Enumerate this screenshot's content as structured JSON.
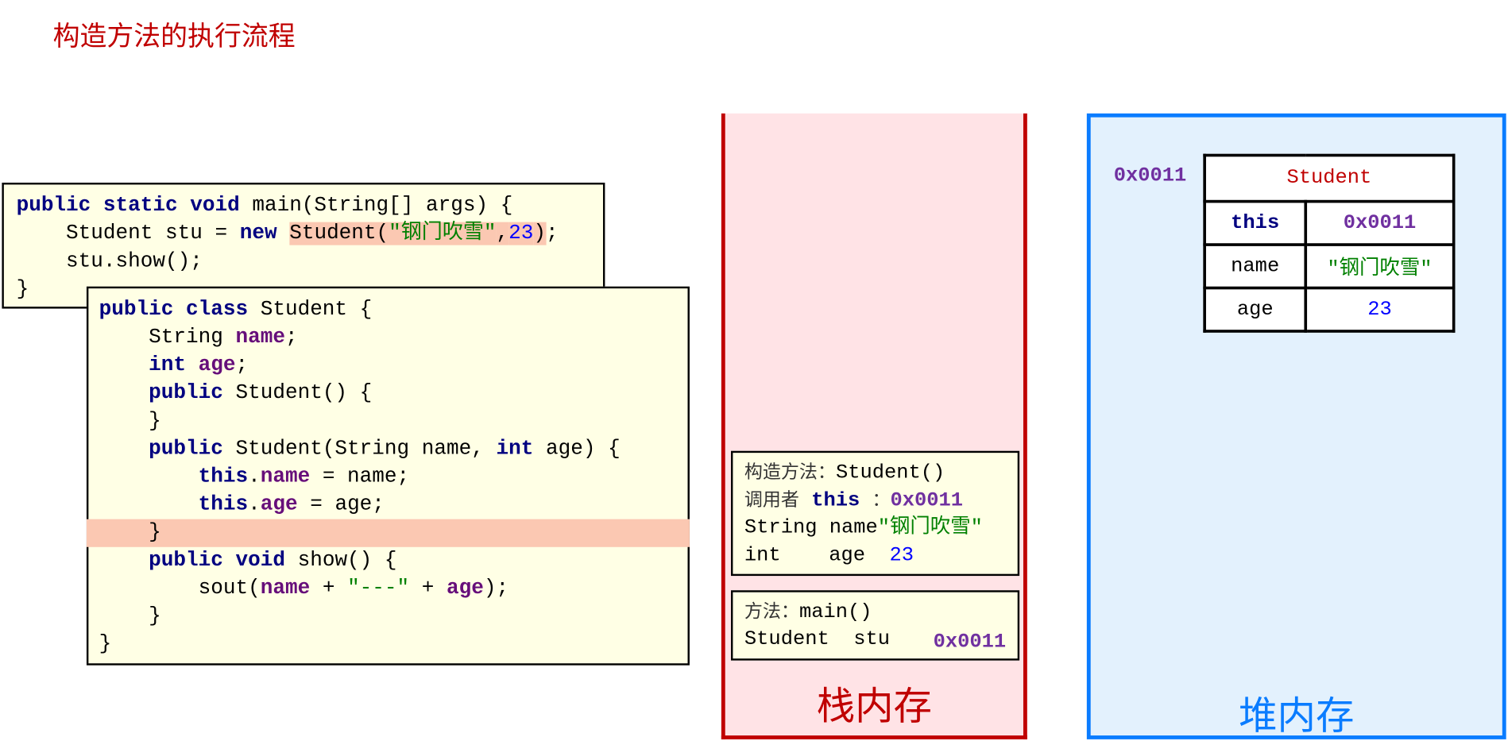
{
  "title": "构造方法的执行流程",
  "main_code": [
    [
      {
        "t": "public static void",
        "c": "kw"
      },
      {
        "t": " main(String[] args) {"
      }
    ],
    [
      {
        "t": "    Student stu = "
      },
      {
        "t": "new",
        "c": "kw"
      },
      {
        "t": " "
      },
      {
        "t": "Student(",
        "h": true
      },
      {
        "t": "\"钢门吹雪\"",
        "c": "st",
        "h": true
      },
      {
        "t": ",",
        "h": true
      },
      {
        "t": "23",
        "c": "nm",
        "h": true
      },
      {
        "t": ")",
        "h": true
      },
      {
        "t": ";"
      }
    ],
    [
      {
        "t": "    stu.show();"
      }
    ],
    [
      {
        "t": "}"
      }
    ]
  ],
  "class_code": [
    [
      {
        "t": "public class",
        "c": "kw"
      },
      {
        "t": " Student {"
      }
    ],
    [
      {
        "t": "    String "
      },
      {
        "t": "name",
        "c": "fd"
      },
      {
        "t": ";"
      }
    ],
    [
      {
        "t": "    "
      },
      {
        "t": "int",
        "c": "kw"
      },
      {
        "t": " "
      },
      {
        "t": "age",
        "c": "fd"
      },
      {
        "t": ";"
      }
    ],
    [
      {
        "t": "    "
      },
      {
        "t": "public",
        "c": "kw"
      },
      {
        "t": " Student() {"
      }
    ],
    [
      {
        "t": "    }"
      }
    ],
    [
      {
        "t": "    "
      },
      {
        "t": "public",
        "c": "kw"
      },
      {
        "t": " Student(String name, "
      },
      {
        "t": "int",
        "c": "kw"
      },
      {
        "t": " age) {"
      }
    ],
    [
      {
        "t": "        "
      },
      {
        "t": "this",
        "c": "kw"
      },
      {
        "t": "."
      },
      {
        "t": "name",
        "c": "fd"
      },
      {
        "t": " = name;"
      }
    ],
    [
      {
        "t": "        "
      },
      {
        "t": "this",
        "c": "kw"
      },
      {
        "t": "."
      },
      {
        "t": "age",
        "c": "fd"
      },
      {
        "t": " = age;"
      }
    ],
    [
      {
        "t": "    }",
        "line_highlight": true
      }
    ],
    [
      {
        "t": "    "
      },
      {
        "t": "public void",
        "c": "kw"
      },
      {
        "t": " show() {"
      }
    ],
    [
      {
        "t": "        sout("
      },
      {
        "t": "name",
        "c": "fd"
      },
      {
        "t": " + "
      },
      {
        "t": "\"---\"",
        "c": "st"
      },
      {
        "t": " + "
      },
      {
        "t": "age",
        "c": "fd"
      },
      {
        "t": ");"
      }
    ],
    [
      {
        "t": "    }"
      }
    ],
    [
      {
        "t": "}"
      }
    ]
  ],
  "stack": {
    "label": "栈内存",
    "color": "#c00000",
    "constructor_frame": {
      "method_label": "构造方法：",
      "method": "Student()",
      "caller_label": "调用者",
      "caller_this": "this",
      "caller_sep": "：",
      "caller_addr": "0x0011",
      "param1_decl": "String name",
      "param1_value": "\"钢门吹雪\"",
      "param2_type": "int",
      "param2_name": "age",
      "param2_value": "23"
    },
    "main_frame": {
      "method_label": "方法：",
      "method": "main()",
      "var_type": "Student",
      "var_name": "stu",
      "var_value": "0x0011"
    }
  },
  "heap": {
    "label": "堆内存",
    "color": "#0a7cff",
    "object_addr": "0x0011",
    "object": {
      "class_name": "Student",
      "rows": [
        {
          "key": "this",
          "value": "0x0011"
        },
        {
          "key": "name",
          "value": "\"钢门吹雪\""
        },
        {
          "key": "age",
          "value": "23"
        }
      ]
    }
  }
}
